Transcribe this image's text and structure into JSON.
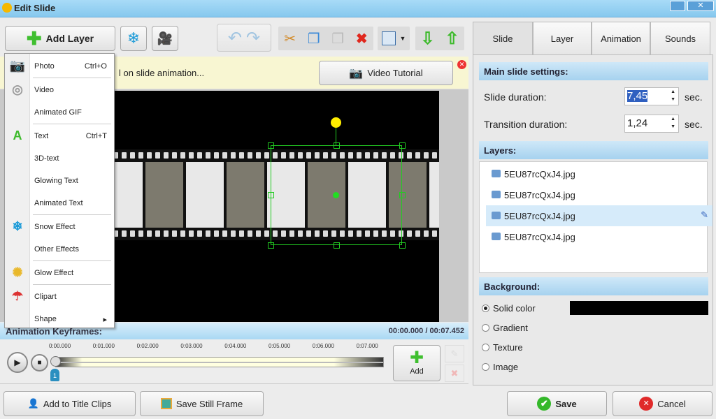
{
  "window": {
    "title": "Edit Slide"
  },
  "toolbar": {
    "add_layer": "Add Layer"
  },
  "hint": {
    "text": "l on slide animation...",
    "video_tutorial": "Video Tutorial"
  },
  "menu": [
    {
      "label": "Photo",
      "shortcut": "Ctrl+O",
      "icon": "camera-icon"
    },
    {
      "label": "Video",
      "shortcut": "",
      "icon": "film-reel-icon"
    },
    {
      "label": "Animated GIF",
      "shortcut": "",
      "icon": ""
    },
    {
      "label": "Text",
      "shortcut": "Ctrl+T",
      "icon": "text-a-icon"
    },
    {
      "label": "3D-text",
      "shortcut": "",
      "icon": ""
    },
    {
      "label": "Glowing Text",
      "shortcut": "",
      "icon": ""
    },
    {
      "label": "Animated Text",
      "shortcut": "",
      "icon": ""
    },
    {
      "label": "Snow Effect",
      "shortcut": "",
      "icon": "snowflake-icon"
    },
    {
      "label": "Other Effects",
      "shortcut": "",
      "icon": ""
    },
    {
      "label": "Glow Effect",
      "shortcut": "",
      "icon": "sparkle-icon"
    },
    {
      "label": "Clipart",
      "shortcut": "",
      "icon": "umbrella-icon"
    },
    {
      "label": "Shape",
      "shortcut": "▸",
      "icon": ""
    }
  ],
  "timeline": {
    "title": "Animation Keyframes:",
    "time": "00:00.000 / 00:07.452",
    "ticks": [
      "0:00.000",
      "0:01.000",
      "0:02.000",
      "0:03.000",
      "0:04.000",
      "0:05.000",
      "0:06.000",
      "0:07.000"
    ],
    "keyframe": "1",
    "add": "Add"
  },
  "bottom": {
    "add_title_clips": "Add to Title Clips",
    "save_still": "Save Still Frame",
    "save": "Save",
    "cancel": "Cancel"
  },
  "tabs": [
    "Slide",
    "Layer",
    "Animation",
    "Sounds"
  ],
  "slide": {
    "main_header": "Main slide settings:",
    "slide_duration_label": "Slide duration:",
    "slide_duration": "7,45",
    "unit": "sec.",
    "transition_label": "Transition duration:",
    "transition": "1,24",
    "layers_header": "Layers:",
    "layers": [
      "5EU87rcQxJ4.jpg",
      "5EU87rcQxJ4.jpg",
      "5EU87rcQxJ4.jpg",
      "5EU87rcQxJ4.jpg"
    ],
    "background_header": "Background:",
    "background_options": [
      "Solid color",
      "Gradient",
      "Texture",
      "Image"
    ],
    "background_color": "#000000"
  },
  "colors": {
    "selection": "#22cc22",
    "handle": "#ffee00",
    "accent": "#a6d2ef"
  }
}
